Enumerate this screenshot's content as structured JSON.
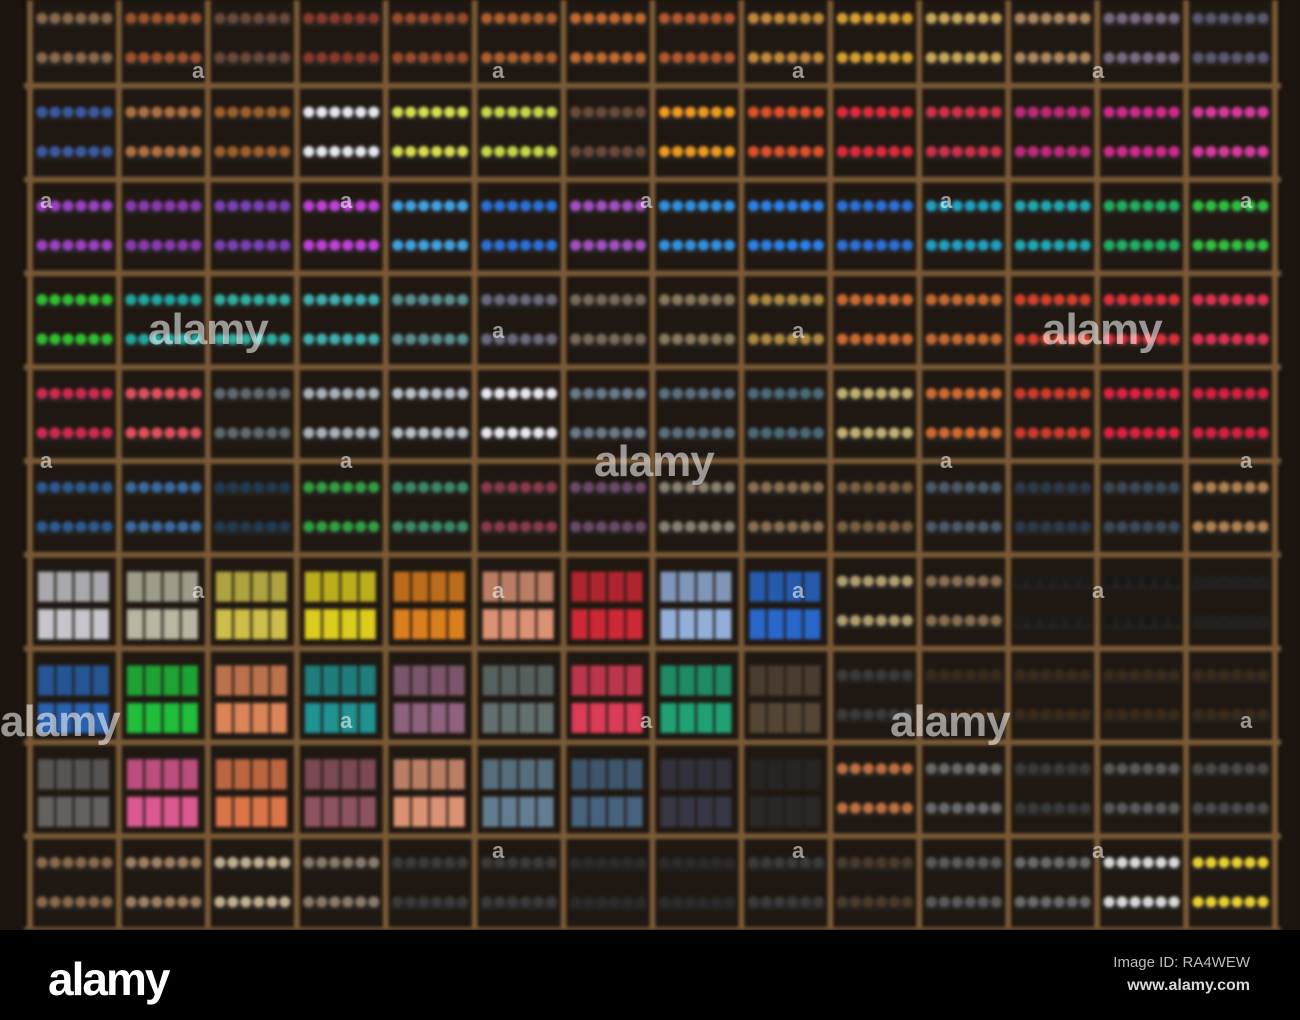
{
  "watermark": {
    "large_text": "alamy",
    "small_text": "a"
  },
  "footer": {
    "logo_text": "alamy",
    "image_id_text": "Image ID: RA4WEW",
    "url_text": "www.alamy.com"
  },
  "colors": {
    "wood": "#7a5a36",
    "cubby_back": "#1f1812",
    "background": "#000000"
  },
  "shelf": {
    "rows": [
      [
        "#8a6a4a",
        "#a0522d",
        "#6b4a3a",
        "#8b3a2a",
        "#9a4b2a",
        "#b0602c",
        "#c26a30",
        "#b5582e",
        "#c58a3a",
        "#d8a030",
        "#c9a85a",
        "#b08860",
        "#7a6a80",
        "#5a5a70"
      ],
      [
        "#3a5aa0",
        "#b07040",
        "#a0602a",
        "#e8e8f0",
        "#d8e050",
        "#c8d848",
        "#6a4a3a",
        "#f09a20",
        "#e0502a",
        "#e02a3a",
        "#d0304a",
        "#c02a7a",
        "#d02a8a",
        "#d83a9a"
      ],
      [
        "#9a40c0",
        "#8a3ab0",
        "#7a40b8",
        "#c040d8",
        "#40a0e0",
        "#2a70d8",
        "#a050c0",
        "#3090e0",
        "#2a80e8",
        "#2a70d8",
        "#20a0c0",
        "#20a8b0",
        "#20b060",
        "#30c040"
      ],
      [
        "#30c030",
        "#20a8a0",
        "#30b0a0",
        "#40b0b0",
        "#5a9090",
        "#6a6a7a",
        "#7a6a5a",
        "#8a7a5a",
        "#b08a40",
        "#d06a30",
        "#c86a30",
        "#d8402a",
        "#e0303a",
        "#e03050"
      ],
      [
        "#d02a50",
        "#e0505a",
        "#606a70",
        "#a8b0b8",
        "#b8c0c8",
        "#e8e8f0",
        "#6a7a8a",
        "#5a7080",
        "#4a6a7a",
        "#c0b070",
        "#d06a30",
        "#d03a2a",
        "#e02040",
        "#d82040"
      ],
      [
        "#2a5a90",
        "#3a6aa0",
        "#203a50",
        "#30a040",
        "#3a8a6a",
        "#8a3a4a",
        "#6a4a6a",
        "#8a8070",
        "#8a7050",
        "#7a6040",
        "#4a5a6a",
        "#2a3a4a",
        "#3a4a5a",
        "#b08050"
      ],
      [
        "#d8d8e0",
        "#c8c8b0",
        "#e0d050",
        "#f0e020",
        "#f08a20",
        "#f0a080",
        "#e02a3a",
        "#a0c0f0",
        "#2a70e0",
        "#b0a070",
        "#8a7050",
        "#1a1a1a",
        "#181818",
        "#202020"
      ],
      [
        "#2a6ac0",
        "#20d040",
        "#f09060",
        "#20a0a0",
        "#9a6a8a",
        "#6a7a7a",
        "#f04060",
        "#20b080",
        "#5a4a3a",
        "#3a3a3a",
        "#3a2a1a",
        "#3a2a1a",
        "#3a2a1a",
        "#3a2a1a"
      ],
      [
        "#6a6a6a",
        "#f060a0",
        "#f08050",
        "#9a5a6a",
        "#f0a080",
        "#6a8aa0",
        "#4a6a8a",
        "#3a3a4a",
        "#2a2a2a",
        "#c07040",
        "#6a6a6a",
        "#3a3a3a",
        "#5a5a5a",
        "#4a4a4a"
      ],
      [
        "#8a6a4a",
        "#a08060",
        "#c0b090",
        "#8a7a6a",
        "#3a3a3a",
        "#3a3a3a",
        "#2a2a2a",
        "#2a2a2a",
        "#3a3a3a",
        "#4a3a2a",
        "#5a5a5a",
        "#6a6a6a",
        "#d8d8d8",
        "#e8d030"
      ]
    ]
  }
}
